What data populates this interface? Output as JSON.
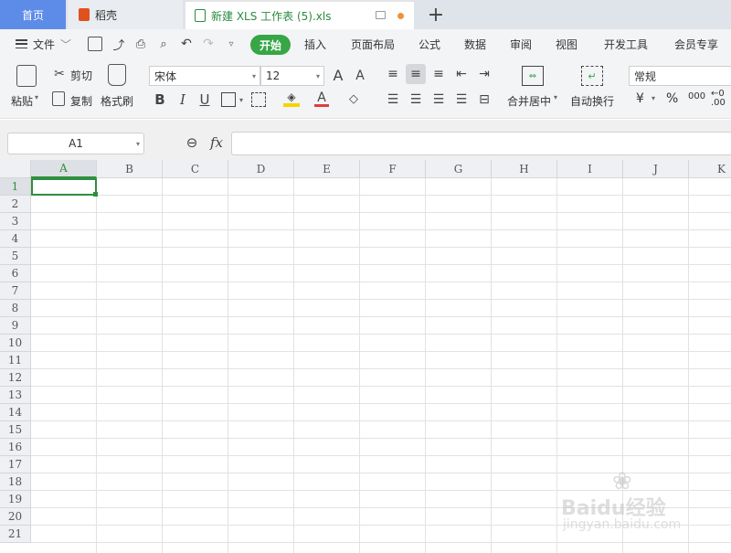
{
  "tabs": {
    "home": "首页",
    "daoke": "稻壳",
    "file": "新建 XLS 工作表 (5).xls"
  },
  "menu": {
    "file": "文件",
    "items": [
      "开始",
      "插入",
      "页面布局",
      "公式",
      "数据",
      "审阅",
      "视图",
      "开发工具",
      "会员专享"
    ]
  },
  "ribbon": {
    "paste": "粘贴",
    "cut": "剪切",
    "copy": "复制",
    "format_painter": "格式刷",
    "font_name": "宋体",
    "font_size": "12",
    "merge_center": "合并居中",
    "wrap_text": "自动换行",
    "number_format": "常规",
    "percent": "%",
    "thousands": "000",
    "currency": "¥"
  },
  "formula_bar": {
    "name_box": "A1",
    "fx": "fx",
    "value": ""
  },
  "sheet": {
    "columns": [
      "A",
      "B",
      "C",
      "D",
      "E",
      "F",
      "G",
      "H",
      "I",
      "J",
      "K"
    ],
    "rows": [
      "1",
      "2",
      "3",
      "4",
      "5",
      "6",
      "7",
      "8",
      "9",
      "10",
      "11",
      "12",
      "13",
      "14",
      "15",
      "16",
      "17",
      "18",
      "19",
      "20",
      "21"
    ],
    "active_cell": "A1"
  },
  "watermark": {
    "brand": "Baidu经验",
    "url": "jingyan.baidu.com"
  },
  "colors": {
    "accent": "#36a646",
    "home_tab": "#5d8be8",
    "active_cell": "#2f8f3f"
  }
}
